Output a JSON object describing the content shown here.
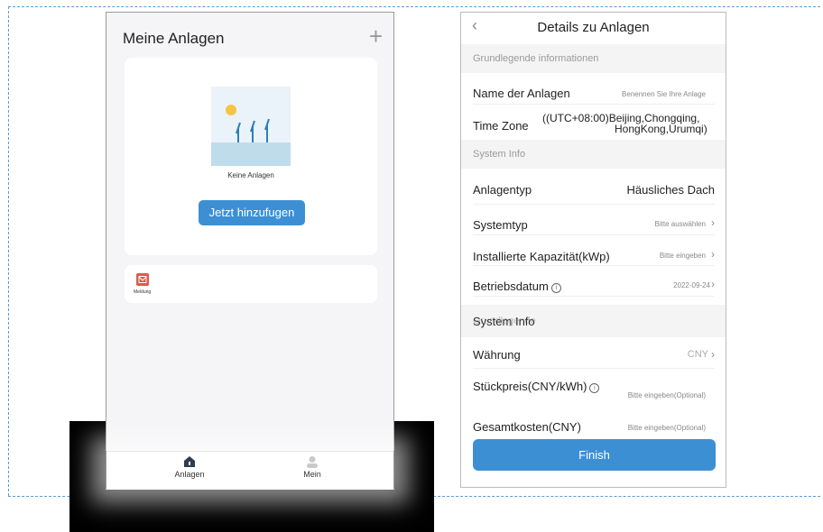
{
  "left": {
    "title": "Meine Anlagen",
    "add_icon": "plus-icon",
    "empty_text": "Keine Anlagen",
    "add_button": "Jetzt hinzufugen",
    "message_label": "Meldung",
    "tabs": [
      {
        "label": "Anlagen",
        "icon": "home-icon"
      },
      {
        "label": "Mein",
        "icon": "user-icon"
      }
    ]
  },
  "right": {
    "title": "Details zu Anlagen",
    "back_icon": "chevron-left-icon",
    "sections": {
      "basic": "Grundlegende informationen",
      "system": "System Info",
      "system2": "System Info",
      "system2_overlap": "Grundlegende"
    },
    "rows": {
      "name_label": "Name der Anlagen",
      "name_placeholder": "Benennen Sie Ihre Anlage",
      "timezone_label": "Time Zone",
      "timezone_line1": "((UTC+08:00)Beijing,Chongqing,",
      "timezone_line2": "HongKong,Urumqi)",
      "type_label": "Anlagentyp",
      "type_value": "Häusliches Dach",
      "systype_label": "Systemtyp",
      "systype_value": "Bitte auswählen",
      "capacity_label": "Installierte Kapazität(kWp)",
      "capacity_value": "Bitte eingeben",
      "date_label": "Betriebsdatum",
      "date_value": "2022-09-24",
      "currency_label": "Währung",
      "currency_value": "CNY",
      "price_label": "Stückpreis(CNY/kWh)",
      "price_value": "Bitte eingeben(Optional)",
      "total_label": "Gesamtkosten(CNY)",
      "total_value": "Bitte eingeben(Optional)"
    },
    "finish": "Finish"
  },
  "colors": {
    "accent": "#3d8fd4",
    "dash": "#5b9bd5"
  }
}
